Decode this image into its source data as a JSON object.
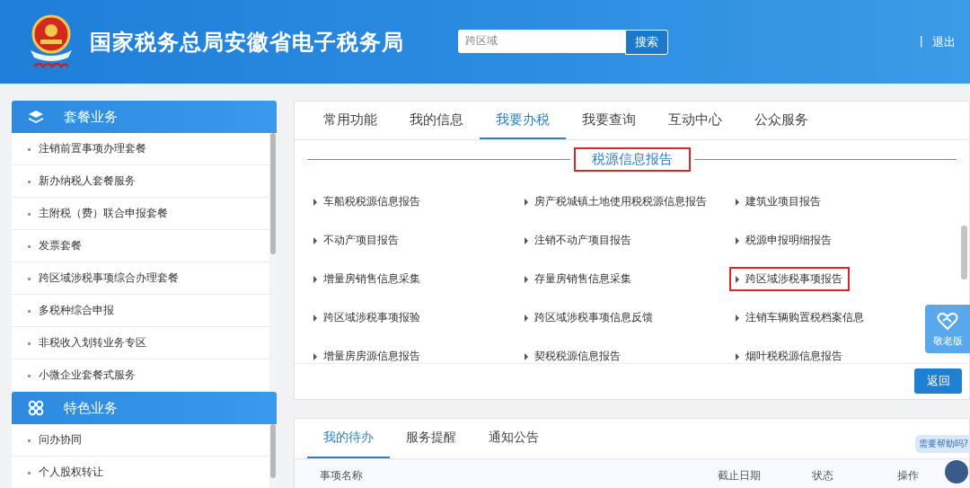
{
  "header": {
    "title": "国家税务总局安徽省电子税务局",
    "search": {
      "value": "跨区域",
      "button": "搜索"
    },
    "separator": "|",
    "logout": "退出"
  },
  "sidebar": [
    {
      "title": "套餐业务",
      "items": [
        "注销前置事项办理套餐",
        "新办纳税人套餐服务",
        "主附税（费）联合申报套餐",
        "发票套餐",
        "跨区域涉税事项综合办理套餐",
        "多税种综合申报",
        "非税收入划转业务专区",
        "小微企业套餐式服务"
      ]
    },
    {
      "title": "特色业务",
      "items": [
        "问办协同",
        "个人股权转让"
      ]
    }
  ],
  "main_tabs": [
    {
      "label": "常用功能",
      "selected": false
    },
    {
      "label": "我的信息",
      "selected": false
    },
    {
      "label": "我要办税",
      "selected": true
    },
    {
      "label": "我要查询",
      "selected": false
    },
    {
      "label": "互动中心",
      "selected": false
    },
    {
      "label": "公众服务",
      "selected": false
    }
  ],
  "section_title": "税源信息报告",
  "links": [
    {
      "label": "车船税税源信息报告",
      "highlighted": false
    },
    {
      "label": "房产税城镇土地使用税税源信息报告",
      "highlighted": false
    },
    {
      "label": "建筑业项目报告",
      "highlighted": false
    },
    {
      "label": "不动产项目报告",
      "highlighted": false
    },
    {
      "label": "注销不动产项目报告",
      "highlighted": false
    },
    {
      "label": "税源申报明细报告",
      "highlighted": false
    },
    {
      "label": "增量房销售信息采集",
      "highlighted": false
    },
    {
      "label": "存量房销售信息采集",
      "highlighted": false
    },
    {
      "label": "跨区域涉税事项报告",
      "highlighted": true
    },
    {
      "label": "跨区域涉税事项报验",
      "highlighted": false
    },
    {
      "label": "跨区域涉税事项信息反馈",
      "highlighted": false
    },
    {
      "label": "注销车辆购置税档案信息",
      "highlighted": false
    },
    {
      "label": "增量房房源信息报告",
      "highlighted": false
    },
    {
      "label": "契税税源信息报告",
      "highlighted": false
    },
    {
      "label": "烟叶税税源信息报告",
      "highlighted": false
    }
  ],
  "back_button": "返回",
  "elder_button": "敬老版",
  "todo_tabs": [
    {
      "label": "我的待办",
      "selected": true
    },
    {
      "label": "服务提醒",
      "selected": false
    },
    {
      "label": "通知公告",
      "selected": false
    }
  ],
  "todo_columns": [
    "事项名称",
    "截止日期",
    "状态",
    "操作"
  ],
  "help_bubble": "需要帮助吗?"
}
